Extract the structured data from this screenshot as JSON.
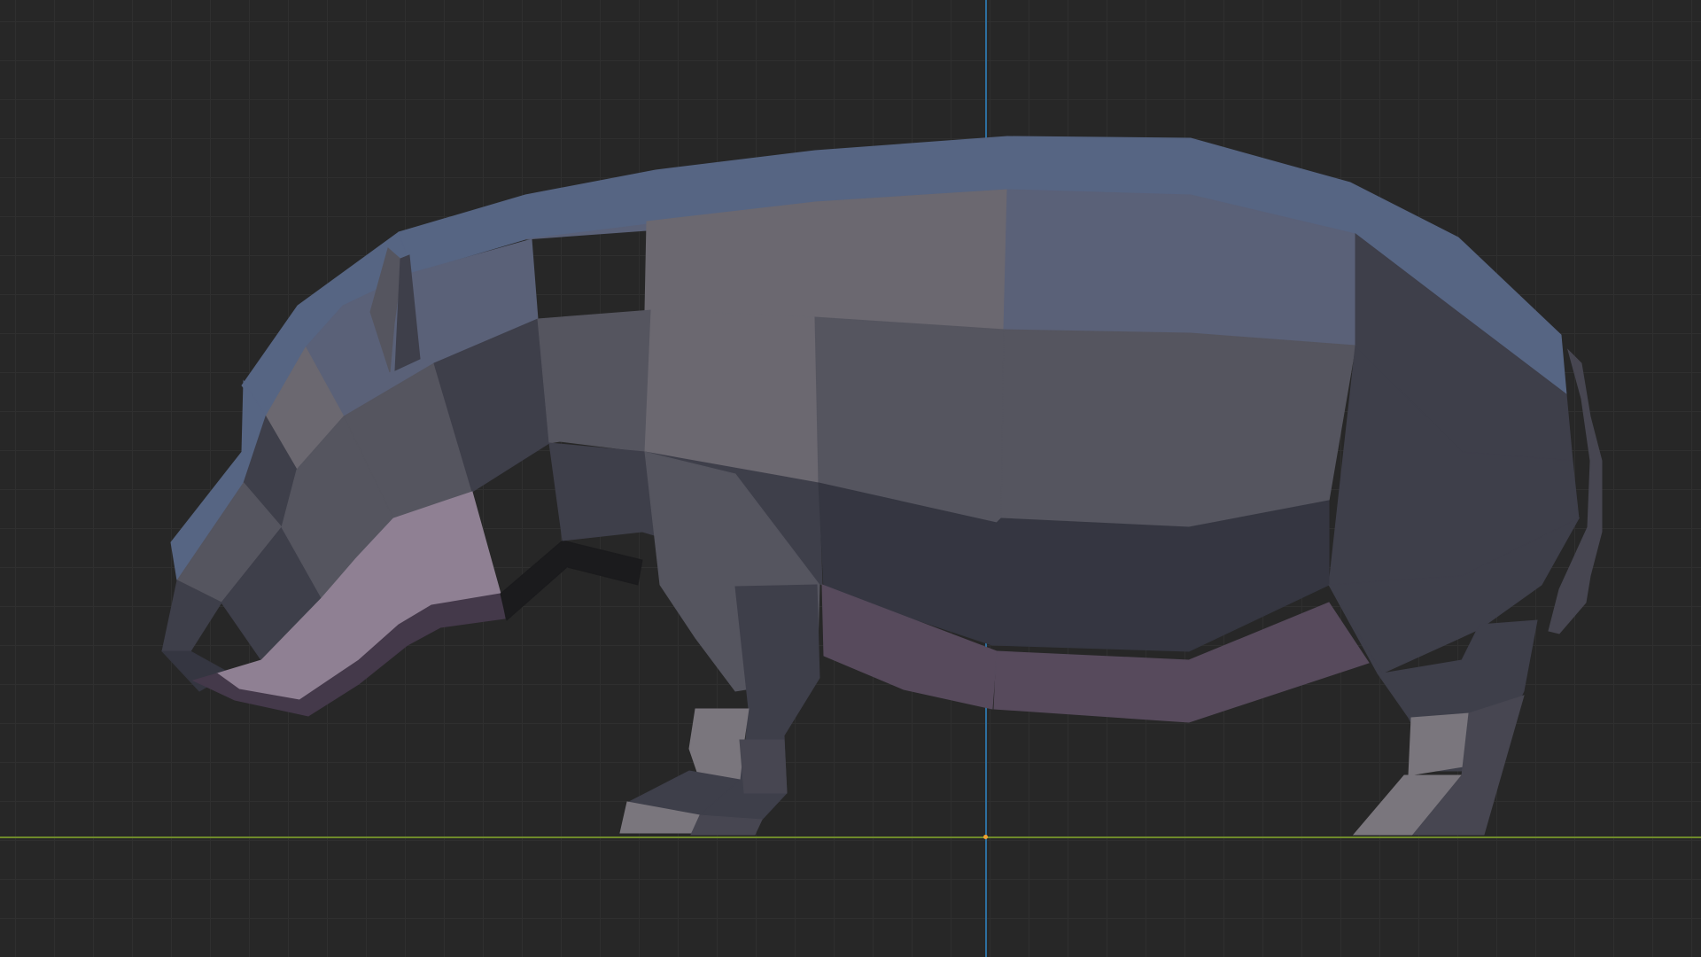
{
  "viewport": {
    "background_color": "#272727",
    "grid_color": "#2f2f2f"
  },
  "axes": {
    "x_axis_color": "#6e8a2a",
    "z_axis_color": "#2d6fa0",
    "origin_color": "#f0a030"
  },
  "model": {
    "icon": "hippo-lowpoly-mesh",
    "palette": {
      "top": "#566583",
      "back": "#5a6178",
      "side_light": "#6b6870",
      "side_mid": "#55555f",
      "side_dark": "#3e3f4a",
      "belly": "#353641",
      "belly_pink": "#574a5c",
      "snout_pink": "#8f8093",
      "snout_shadow": "#44394a",
      "leg_light": "#7a767d",
      "leg_dark": "#474651",
      "shadow": "#1b1b1d"
    }
  }
}
